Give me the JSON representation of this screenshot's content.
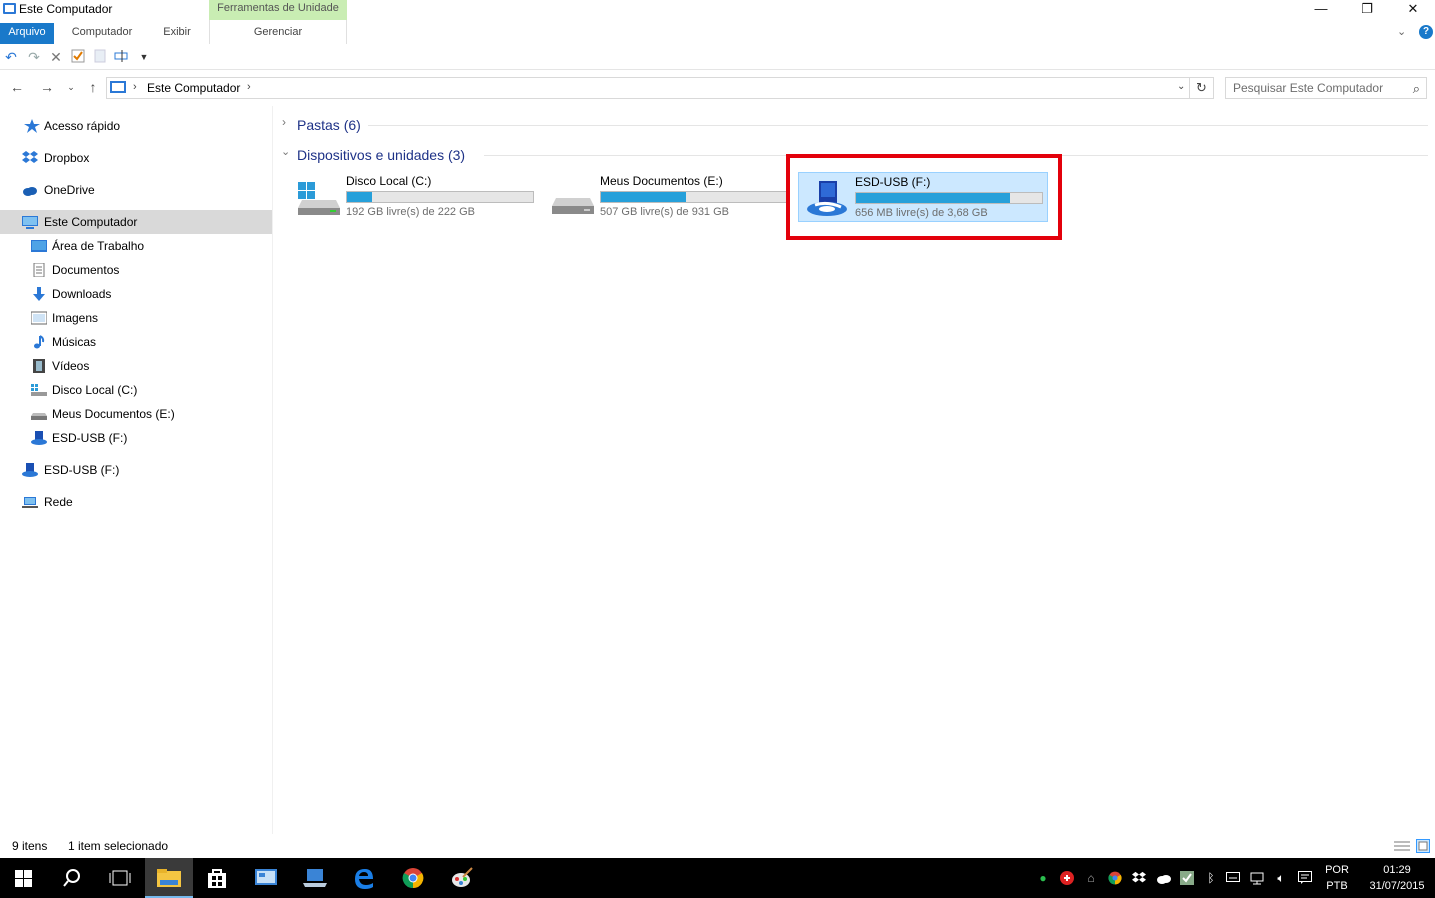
{
  "window": {
    "title": "Este Computador",
    "context_tab_group": "Ferramentas de Unidade",
    "minimize": "—",
    "maximize": "❐",
    "close": "✕"
  },
  "ribbon": {
    "tabs": [
      {
        "label": "Arquivo"
      },
      {
        "label": "Computador"
      },
      {
        "label": "Exibir"
      },
      {
        "label": "Gerenciar"
      }
    ],
    "help": "?"
  },
  "address": {
    "crumb": "Este Computador",
    "search_placeholder": "Pesquisar Este Computador"
  },
  "sidebar": {
    "items": [
      {
        "label": "Acesso rápido",
        "icon": "star-icon"
      },
      {
        "label": "Dropbox",
        "icon": "dropbox-icon"
      },
      {
        "label": "OneDrive",
        "icon": "cloud-icon"
      },
      {
        "label": "Este Computador",
        "icon": "computer-icon"
      },
      {
        "label": "Área de Trabalho",
        "icon": "desktop-icon"
      },
      {
        "label": "Documentos",
        "icon": "documents-icon"
      },
      {
        "label": "Downloads",
        "icon": "download-icon"
      },
      {
        "label": "Imagens",
        "icon": "pictures-icon"
      },
      {
        "label": "Músicas",
        "icon": "music-icon"
      },
      {
        "label": "Vídeos",
        "icon": "videos-icon"
      },
      {
        "label": "Disco Local (C:)",
        "icon": "windows-drive-icon"
      },
      {
        "label": "Meus Documentos (E:)",
        "icon": "drive-icon"
      },
      {
        "label": "ESD-USB (F:)",
        "icon": "usb-setup-icon"
      },
      {
        "label": "ESD-USB (F:)",
        "icon": "usb-setup-icon"
      },
      {
        "label": "Rede",
        "icon": "network-icon"
      }
    ]
  },
  "main": {
    "groups": [
      {
        "label": "Pastas (6)"
      },
      {
        "label": "Dispositivos e unidades (3)"
      }
    ],
    "drives": [
      {
        "name": "Disco Local (C:)",
        "free": "192 GB livre(s) de 222 GB",
        "used_fraction": 0.135
      },
      {
        "name": "Meus Documentos (E:)",
        "free": "507 GB livre(s) de 931 GB",
        "used_fraction": 0.455
      },
      {
        "name": "ESD-USB (F:)",
        "free": "656 MB livre(s) de 3,68 GB",
        "used_fraction": 0.826
      }
    ]
  },
  "status": {
    "items": "9 itens",
    "selected": "1 item selecionado"
  },
  "taskbar": {
    "lang1": "POR",
    "lang2": "PTB",
    "time": "01:29",
    "date": "31/07/2015"
  },
  "colors": {
    "accent": "#1979ca",
    "progress": "#26a0da",
    "selection": "#cce8ff",
    "highlight": "#e3000b"
  }
}
